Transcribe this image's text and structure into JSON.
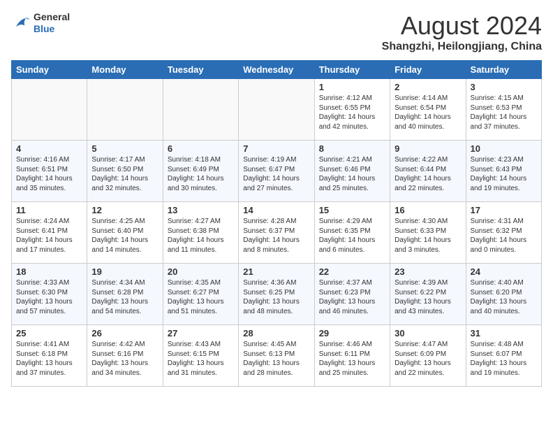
{
  "logo": {
    "general": "General",
    "blue": "Blue"
  },
  "header": {
    "month": "August 2024",
    "location": "Shangzhi, Heilongjiang, China"
  },
  "weekdays": [
    "Sunday",
    "Monday",
    "Tuesday",
    "Wednesday",
    "Thursday",
    "Friday",
    "Saturday"
  ],
  "weeks": [
    [
      {
        "day": "",
        "info": ""
      },
      {
        "day": "",
        "info": ""
      },
      {
        "day": "",
        "info": ""
      },
      {
        "day": "",
        "info": ""
      },
      {
        "day": "1",
        "info": "Sunrise: 4:12 AM\nSunset: 6:55 PM\nDaylight: 14 hours\nand 42 minutes."
      },
      {
        "day": "2",
        "info": "Sunrise: 4:14 AM\nSunset: 6:54 PM\nDaylight: 14 hours\nand 40 minutes."
      },
      {
        "day": "3",
        "info": "Sunrise: 4:15 AM\nSunset: 6:53 PM\nDaylight: 14 hours\nand 37 minutes."
      }
    ],
    [
      {
        "day": "4",
        "info": "Sunrise: 4:16 AM\nSunset: 6:51 PM\nDaylight: 14 hours\nand 35 minutes."
      },
      {
        "day": "5",
        "info": "Sunrise: 4:17 AM\nSunset: 6:50 PM\nDaylight: 14 hours\nand 32 minutes."
      },
      {
        "day": "6",
        "info": "Sunrise: 4:18 AM\nSunset: 6:49 PM\nDaylight: 14 hours\nand 30 minutes."
      },
      {
        "day": "7",
        "info": "Sunrise: 4:19 AM\nSunset: 6:47 PM\nDaylight: 14 hours\nand 27 minutes."
      },
      {
        "day": "8",
        "info": "Sunrise: 4:21 AM\nSunset: 6:46 PM\nDaylight: 14 hours\nand 25 minutes."
      },
      {
        "day": "9",
        "info": "Sunrise: 4:22 AM\nSunset: 6:44 PM\nDaylight: 14 hours\nand 22 minutes."
      },
      {
        "day": "10",
        "info": "Sunrise: 4:23 AM\nSunset: 6:43 PM\nDaylight: 14 hours\nand 19 minutes."
      }
    ],
    [
      {
        "day": "11",
        "info": "Sunrise: 4:24 AM\nSunset: 6:41 PM\nDaylight: 14 hours\nand 17 minutes."
      },
      {
        "day": "12",
        "info": "Sunrise: 4:25 AM\nSunset: 6:40 PM\nDaylight: 14 hours\nand 14 minutes."
      },
      {
        "day": "13",
        "info": "Sunrise: 4:27 AM\nSunset: 6:38 PM\nDaylight: 14 hours\nand 11 minutes."
      },
      {
        "day": "14",
        "info": "Sunrise: 4:28 AM\nSunset: 6:37 PM\nDaylight: 14 hours\nand 8 minutes."
      },
      {
        "day": "15",
        "info": "Sunrise: 4:29 AM\nSunset: 6:35 PM\nDaylight: 14 hours\nand 6 minutes."
      },
      {
        "day": "16",
        "info": "Sunrise: 4:30 AM\nSunset: 6:33 PM\nDaylight: 14 hours\nand 3 minutes."
      },
      {
        "day": "17",
        "info": "Sunrise: 4:31 AM\nSunset: 6:32 PM\nDaylight: 14 hours\nand 0 minutes."
      }
    ],
    [
      {
        "day": "18",
        "info": "Sunrise: 4:33 AM\nSunset: 6:30 PM\nDaylight: 13 hours\nand 57 minutes."
      },
      {
        "day": "19",
        "info": "Sunrise: 4:34 AM\nSunset: 6:28 PM\nDaylight: 13 hours\nand 54 minutes."
      },
      {
        "day": "20",
        "info": "Sunrise: 4:35 AM\nSunset: 6:27 PM\nDaylight: 13 hours\nand 51 minutes."
      },
      {
        "day": "21",
        "info": "Sunrise: 4:36 AM\nSunset: 6:25 PM\nDaylight: 13 hours\nand 48 minutes."
      },
      {
        "day": "22",
        "info": "Sunrise: 4:37 AM\nSunset: 6:23 PM\nDaylight: 13 hours\nand 46 minutes."
      },
      {
        "day": "23",
        "info": "Sunrise: 4:39 AM\nSunset: 6:22 PM\nDaylight: 13 hours\nand 43 minutes."
      },
      {
        "day": "24",
        "info": "Sunrise: 4:40 AM\nSunset: 6:20 PM\nDaylight: 13 hours\nand 40 minutes."
      }
    ],
    [
      {
        "day": "25",
        "info": "Sunrise: 4:41 AM\nSunset: 6:18 PM\nDaylight: 13 hours\nand 37 minutes."
      },
      {
        "day": "26",
        "info": "Sunrise: 4:42 AM\nSunset: 6:16 PM\nDaylight: 13 hours\nand 34 minutes."
      },
      {
        "day": "27",
        "info": "Sunrise: 4:43 AM\nSunset: 6:15 PM\nDaylight: 13 hours\nand 31 minutes."
      },
      {
        "day": "28",
        "info": "Sunrise: 4:45 AM\nSunset: 6:13 PM\nDaylight: 13 hours\nand 28 minutes."
      },
      {
        "day": "29",
        "info": "Sunrise: 4:46 AM\nSunset: 6:11 PM\nDaylight: 13 hours\nand 25 minutes."
      },
      {
        "day": "30",
        "info": "Sunrise: 4:47 AM\nSunset: 6:09 PM\nDaylight: 13 hours\nand 22 minutes."
      },
      {
        "day": "31",
        "info": "Sunrise: 4:48 AM\nSunset: 6:07 PM\nDaylight: 13 hours\nand 19 minutes."
      }
    ]
  ]
}
